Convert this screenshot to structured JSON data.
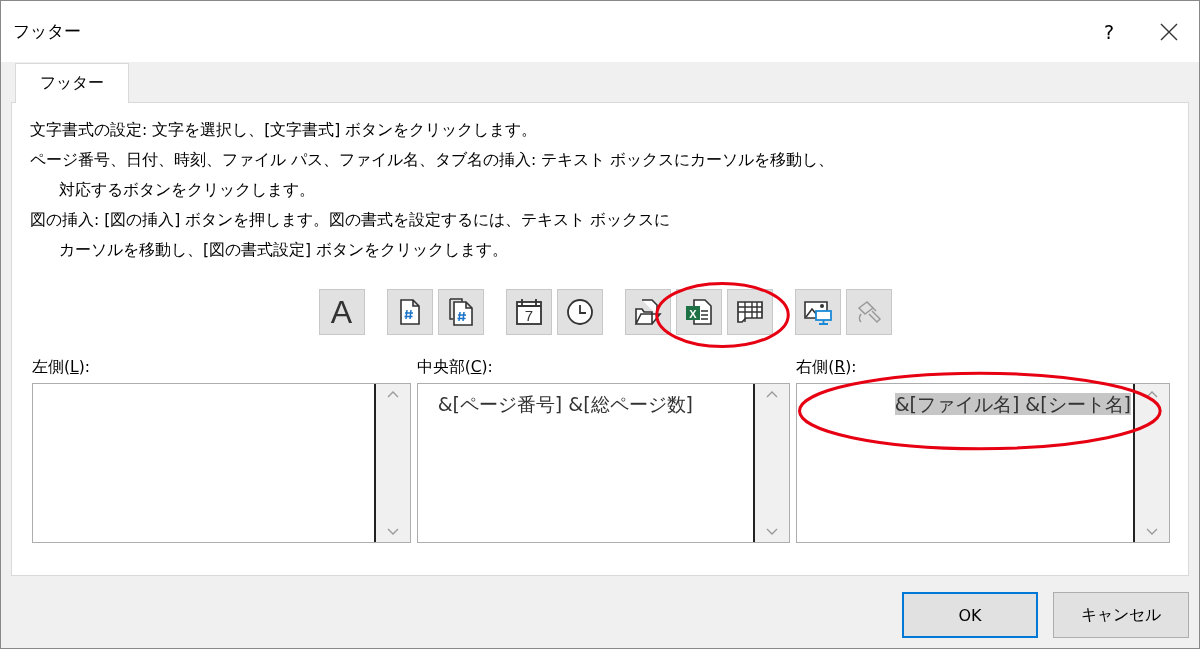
{
  "window": {
    "title": "フッター",
    "help": "?"
  },
  "tabs": [
    {
      "label": "フッター",
      "selected": true
    }
  ],
  "instructions": [
    {
      "lines": [
        "文字書式の設定: 文字を選択し、[文字書式] ボタンをクリックします。"
      ]
    },
    {
      "lines": [
        "ページ番号、日付、時刻、ファイル パス、ファイル名、タブ名の挿入: テキスト ボックスにカーソルを移動し、",
        "対応するボタンをクリックします。"
      ]
    },
    {
      "lines": [
        "図の挿入: [図の挿入] ボタンを押します。図の書式を設定するには、テキスト ボックスに",
        "カーソルを移動し、[図の書式設定] ボタンをクリックします。"
      ]
    }
  ],
  "toolbar": [
    [
      {
        "kind": "font",
        "label": "A",
        "disabled": false,
        "circled": false
      }
    ],
    [
      {
        "kind": "page-number",
        "disabled": false,
        "circled": false
      },
      {
        "kind": "page-count",
        "disabled": false,
        "circled": false
      }
    ],
    [
      {
        "kind": "date",
        "label": "7",
        "disabled": false,
        "circled": false
      },
      {
        "kind": "time",
        "disabled": false,
        "circled": false
      }
    ],
    [
      {
        "kind": "file-path",
        "disabled": false,
        "circled": false
      },
      {
        "kind": "file-name",
        "label": "X",
        "disabled": false,
        "circled": true
      },
      {
        "kind": "sheet-name",
        "disabled": false,
        "circled": true
      }
    ],
    [
      {
        "kind": "picture",
        "disabled": false,
        "circled": false
      },
      {
        "kind": "format-picture",
        "disabled": true,
        "circled": false
      }
    ]
  ],
  "sections": [
    {
      "label_before": "左側(",
      "access_key": "L",
      "label_after": "):",
      "circled": false
    },
    {
      "label_before": "中央部(",
      "access_key": "C",
      "label_after": "):",
      "text": "&[ページ番号] &[総ページ数]",
      "selected": false,
      "circled": false
    },
    {
      "label_before": "右側(",
      "access_key": "R",
      "label_after": "):",
      "text": "&[ファイル名] &[シート名]",
      "selected": true,
      "circled": true
    }
  ],
  "buttons": [
    {
      "label": "OK",
      "default": true
    },
    {
      "label": "キャンセル",
      "default": false
    }
  ]
}
